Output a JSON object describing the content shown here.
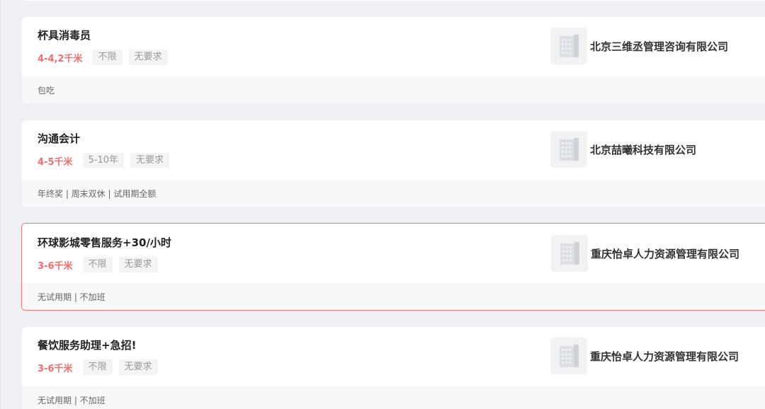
{
  "jobs": [
    {
      "title": "杯具消毒员",
      "salary": "4-4,2千米",
      "tags": [
        "不限",
        "无要求"
      ],
      "company": "北京三维丞管理咨询有限公司",
      "company_logo_icon": "building-icon",
      "benefits": "包吃",
      "active": false
    },
    {
      "title": "沟通会计",
      "salary": "4-5千米",
      "tags": [
        "5-10年",
        "无要求"
      ],
      "company": "北京喆曦科技有限公司",
      "company_logo_icon": "building-icon",
      "benefits": "年终奖 | 周末双休 | 试用期全额",
      "active": false
    },
    {
      "title": "环球影城零售服务+30/小时",
      "salary": "3-6千米",
      "tags": [
        "不限",
        "无要求"
      ],
      "company": "重庆怡卓人力资源管理有限公司",
      "company_logo_icon": "building-icon",
      "benefits": "无试用期 | 不加班",
      "active": true
    },
    {
      "title": "餐饮服务助理+急招!",
      "salary": "3-6千米",
      "tags": [
        "不限",
        "无要求"
      ],
      "company": "重庆怡卓人力资源管理有限公司",
      "company_logo_icon": "building-icon",
      "benefits": "无试用期 | 不加班",
      "active": false
    }
  ],
  "colors": {
    "salary": "#f26d6d",
    "active_border": "#f07a7a",
    "background": "#eef0f3"
  }
}
